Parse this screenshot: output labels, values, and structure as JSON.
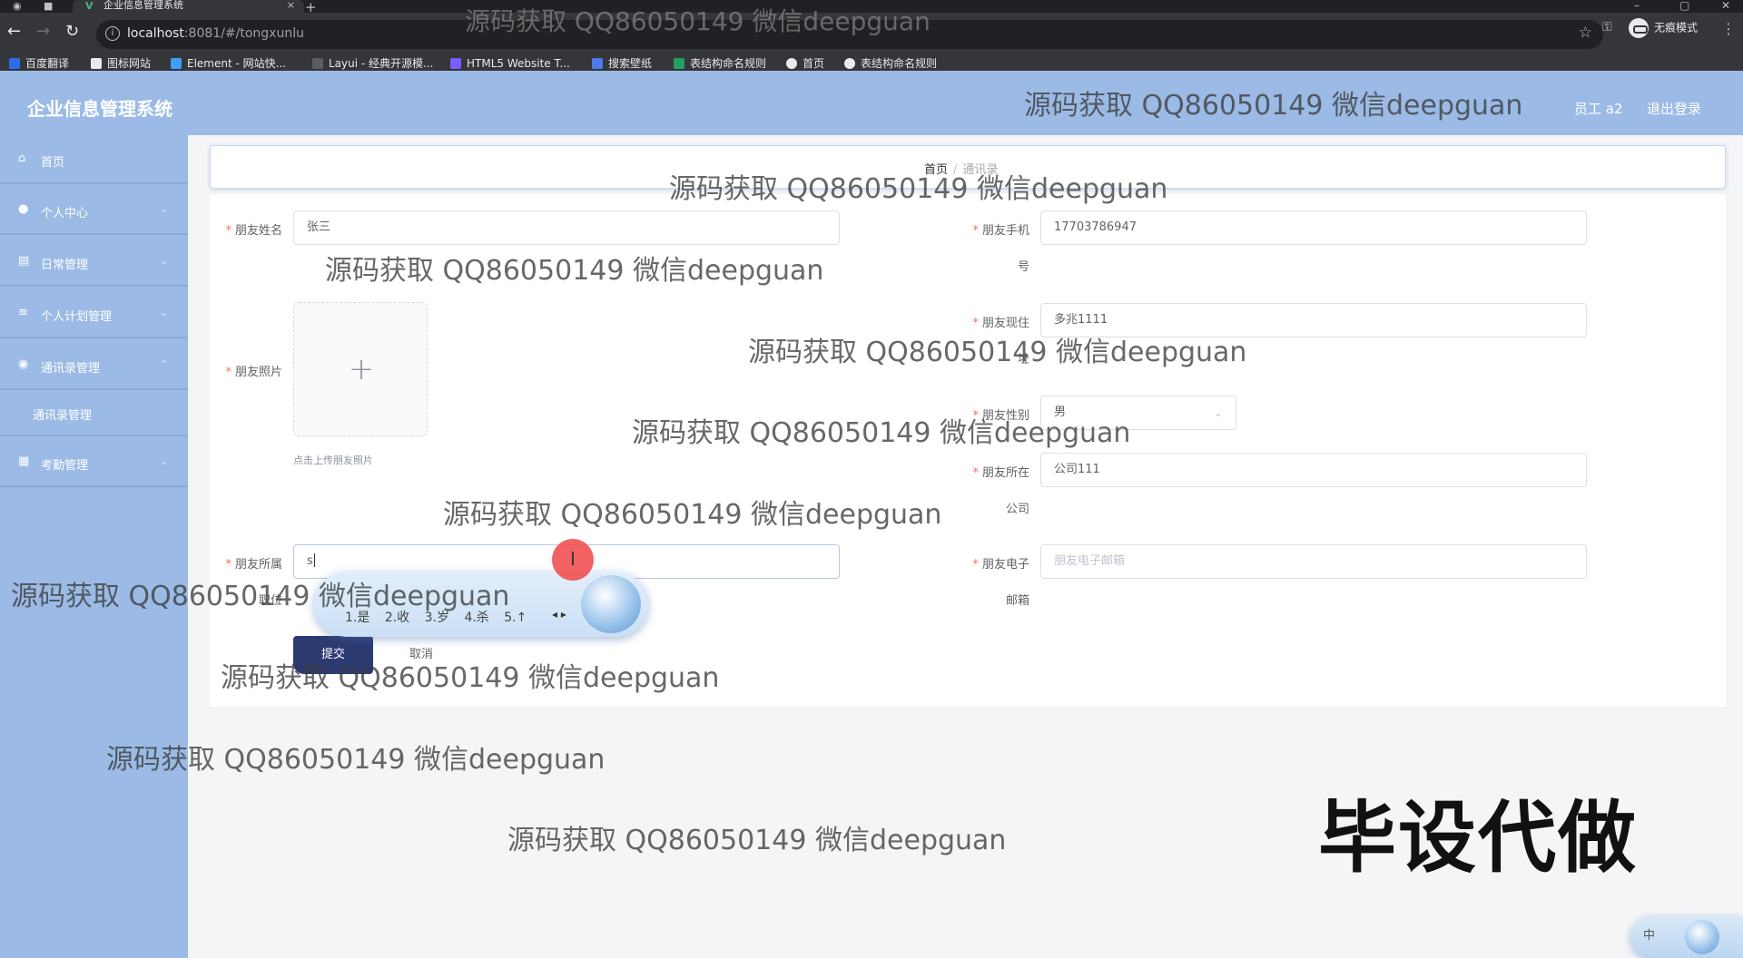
{
  "browser": {
    "tab_title": "企业信息管理系统",
    "address_host": "localhost",
    "address_path": ":8081/#/tongxunlu",
    "profile_label": "无痕模式",
    "bookmarks": [
      {
        "label": "百度翻译",
        "color": "#2b6de8"
      },
      {
        "label": "图标网站",
        "color": "#e8eaed"
      },
      {
        "label": "Element - 网站快...",
        "color": "#409eff"
      },
      {
        "label": "Layui - 经典开源模...",
        "color": "#e8eaed"
      },
      {
        "label": "HTML5 Website T...",
        "color": "#7c5cff"
      },
      {
        "label": "搜索壁纸",
        "color": "#4e7be8"
      },
      {
        "label": "表结构命名规则",
        "color": "#22a060"
      },
      {
        "label": "首页",
        "color": "#e8eaed"
      },
      {
        "label": "表结构命名规则",
        "color": "#e8eaed"
      }
    ]
  },
  "header": {
    "brand": "企业信息管理系统",
    "user": "员工 a2",
    "logout": "退出登录"
  },
  "sidebar": {
    "items": [
      {
        "label": "首页",
        "icon": "home-icon",
        "glyph": "⌂"
      },
      {
        "label": "个人中心",
        "icon": "user-icon",
        "glyph": "●"
      },
      {
        "label": "日常管理",
        "icon": "document-icon",
        "glyph": "▤"
      },
      {
        "label": "个人计划管理",
        "icon": "list-icon",
        "glyph": "≡"
      },
      {
        "label": "通讯录管理",
        "icon": "info-icon",
        "glyph": "◉"
      },
      {
        "label": "考勤管理",
        "icon": "grid-icon",
        "glyph": "▦"
      }
    ],
    "sub_items": [
      {
        "label": "通讯录管理"
      }
    ]
  },
  "breadcrumb": {
    "home": "首页",
    "separator": "/",
    "current": "通讯录"
  },
  "form": {
    "name_label": "朋友姓名",
    "name_value": "张三",
    "phone_label_1": "朋友手机",
    "phone_label_2": "号",
    "phone_value": "17703786947",
    "photo_label": "朋友照片",
    "photo_plus": "+",
    "photo_hint": "点击上传朋友照片",
    "address_label_1": "朋友现住",
    "address_label_2": "址",
    "address_value": "多兆1111",
    "gender_label": "朋友性别",
    "gender_value": "男",
    "company_label_1": "朋友所在",
    "company_label_2": "公司",
    "company_value": "公司111",
    "position_label_1": "朋友所属",
    "position_label_2": "职位",
    "position_value": "s",
    "email_label_1": "朋友电子",
    "email_label_2": "邮箱",
    "email_placeholder": "朋友电子邮箱",
    "submit": "提交",
    "cancel": "取消"
  },
  "ime": {
    "candidates": [
      "1.是",
      "2.收",
      "3.岁",
      "4.杀",
      "5.↑"
    ],
    "paging": "◂ ▸",
    "mode": "中"
  },
  "watermark": "源码获取 QQ86050149 微信deepguan",
  "stamp": "毕设代做"
}
